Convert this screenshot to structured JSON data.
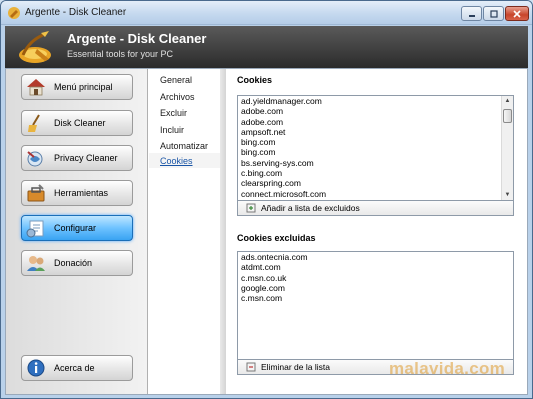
{
  "window": {
    "title": "Argente - Disk Cleaner"
  },
  "header": {
    "app_title": "Argente - Disk Cleaner",
    "subtitle": "Essential tools for your PC"
  },
  "sidebar": {
    "items": [
      {
        "label": "Menú principal",
        "icon": "house-icon"
      },
      {
        "label": "Disk Cleaner",
        "icon": "broom-icon"
      },
      {
        "label": "Privacy Cleaner",
        "icon": "privacy-icon"
      },
      {
        "label": "Herramientas",
        "icon": "toolbox-icon"
      },
      {
        "label": "Configurar",
        "icon": "settings-icon",
        "active": true
      },
      {
        "label": "Donación",
        "icon": "users-icon"
      }
    ],
    "about": {
      "label": "Acerca de",
      "icon": "info-icon"
    }
  },
  "subnav": {
    "items": [
      {
        "label": "General"
      },
      {
        "label": "Archivos"
      },
      {
        "label": "Excluir"
      },
      {
        "label": "Incluir"
      },
      {
        "label": "Automatizar"
      },
      {
        "label": "Cookies",
        "active": true
      }
    ]
  },
  "cookies": {
    "title": "Cookies",
    "items": [
      "ad.yieldmanager.com",
      "adobe.com",
      "adobe.com",
      "ampsoft.net",
      "bing.com",
      "bing.com",
      "bs.serving-sys.com",
      "c.bing.com",
      "clearspring.com",
      "connect.microsoft.com"
    ],
    "action_label": "Añadir a lista de excluidos"
  },
  "excluded": {
    "title": "Cookies excluidas",
    "items": [
      "ads.ontecnia.com",
      "atdmt.com",
      "c.msn.co.uk",
      "google.com",
      "c.msn.com"
    ],
    "action_label": "Eliminar de la lista"
  },
  "watermark": "malavida.com",
  "colors": {
    "active_button": "#39a3f2",
    "header_bg": "#2b2b2b",
    "link": "#1a55a6"
  }
}
